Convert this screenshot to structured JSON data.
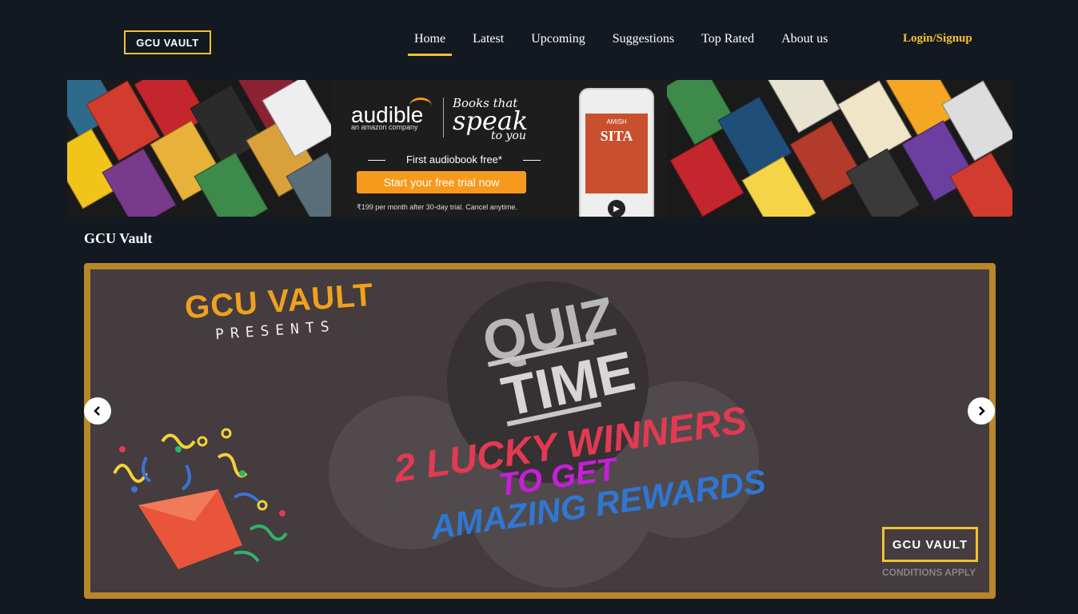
{
  "header": {
    "logo": "GCU VAULT",
    "nav": [
      "Home",
      "Latest",
      "Upcoming",
      "Suggestions",
      "Top Rated",
      "About us"
    ],
    "active_nav": "Home",
    "login": "Login/Signup"
  },
  "ad": {
    "brand": "audible",
    "brand_sub": "an amazon company",
    "tagline_1": "Books that",
    "tagline_2": "speak",
    "tagline_3": "to you",
    "offer": "First audiobook free*",
    "cta": "Start your free trial now",
    "price_note": "₹199 per month after 30-day trial. Cancel anytime.",
    "phone_author": "AMISH",
    "phone_title": "SITA"
  },
  "section": {
    "title": "GCU Vault"
  },
  "slide": {
    "brand": "GCU VAULT",
    "presents": "PRESENTS",
    "quiz": "QUIZ",
    "time": "TIME",
    "line1": "2 LUCKY WINNERS",
    "line2": "TO GET",
    "line3": "AMAZING  REWARDS",
    "logo": "GCU VAULT",
    "conditions": "CONDITIONS APPLY"
  },
  "colors": {
    "accent": "#f2c230",
    "background": "#131921",
    "frame": "#b8862b"
  }
}
